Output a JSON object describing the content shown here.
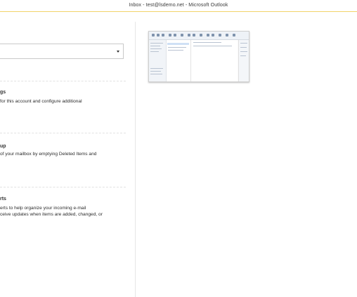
{
  "window": {
    "title": "Inbox - test@lsdemo.net  -  Microsoft Outlook"
  },
  "sections": [
    {
      "heading": "gs",
      "lines": [
        "for this account and configure additional"
      ]
    },
    {
      "heading": "up",
      "lines": [
        "of your mailbox by emptying Deleted Items and"
      ]
    },
    {
      "heading": "rts",
      "lines": [
        "erts to help organize your incoming e-mail",
        "ceive updates when items are added, changed, or"
      ]
    }
  ],
  "colors": {
    "accent_line": "#f2d46a",
    "divider": "#e6e6e6"
  },
  "icons": {
    "account_dropdown": "chevron-down-icon"
  }
}
